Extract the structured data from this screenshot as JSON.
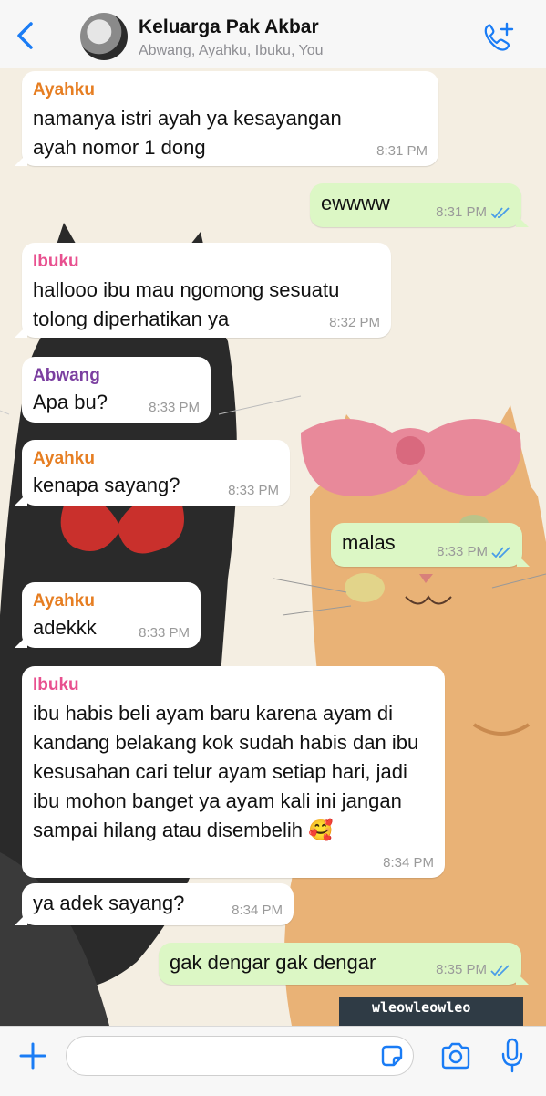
{
  "header": {
    "title": "Keluarga Pak Akbar",
    "subtitle": "Abwang, Ayahku, Ibuku, You"
  },
  "colors": {
    "ayahku": "#e67e22",
    "ibuku": "#e8508f",
    "abwang": "#7b3fa0",
    "accent": "#1a7cf5",
    "read_ticks": "#4a9de8"
  },
  "messages": [
    {
      "sender": "Ayahku",
      "text": "namanya istri ayah ya kesayangan ayah nomor 1 dong",
      "time": "8:31 PM"
    },
    {
      "sender": "You",
      "text": "ewwww",
      "time": "8:31 PM"
    },
    {
      "sender": "Ibuku",
      "text": "hallooo ibu mau ngomong sesuatu tolong diperhatikan ya",
      "time": "8:32 PM"
    },
    {
      "sender": "Abwang",
      "text": "Apa bu?",
      "time": "8:33 PM"
    },
    {
      "sender": "Ayahku",
      "text": "kenapa sayang?",
      "time": "8:33 PM"
    },
    {
      "sender": "You",
      "text": "malas",
      "time": "8:33 PM"
    },
    {
      "sender": "Ayahku",
      "text": "adekkk",
      "time": "8:33 PM"
    },
    {
      "sender": "Ibuku",
      "text": "ibu habis beli ayam baru karena ayam di kandang belakang kok sudah habis dan ibu kesusahan cari telur ayam setiap hari, jadi ibu mohon banget ya ayam kali ini jangan sampai hilang atau disembelih 🥰",
      "time": "8:34 PM"
    },
    {
      "sender": "Ibuku",
      "text": "ya adek sayang?",
      "time": "8:34 PM"
    },
    {
      "sender": "You",
      "text": "gak dengar gak dengar",
      "time": "8:35 PM"
    }
  ],
  "sticker_text": "wleowleowleo",
  "composer": {
    "placeholder": ""
  },
  "icons": [
    "chevron-left-icon",
    "phone-plus-icon",
    "plus-icon",
    "sticker-icon",
    "camera-icon",
    "microphone-icon",
    "double-check-icon"
  ]
}
